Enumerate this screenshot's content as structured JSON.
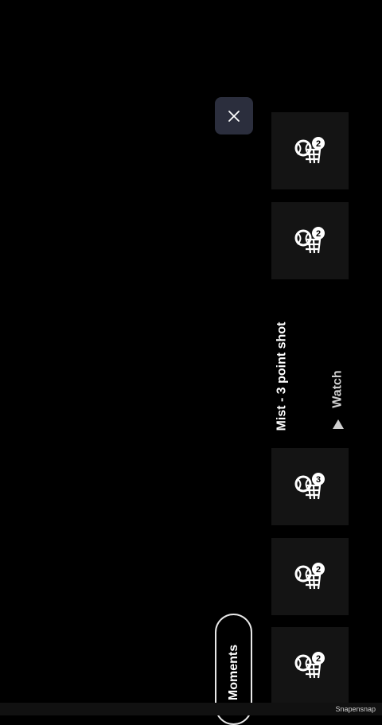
{
  "header": {
    "close_icon": "close-icon"
  },
  "moments": [
    {
      "icon": "basketball-hoop-icon",
      "count": "2"
    },
    {
      "icon": "basketball-hoop-icon",
      "count": "2"
    },
    {
      "icon": "basketball-hoop-icon",
      "count": "3"
    },
    {
      "icon": "basketball-hoop-icon",
      "count": "2"
    },
    {
      "icon": "basketball-hoop-icon",
      "count": "2"
    }
  ],
  "event": {
    "title": "Mist - 3 point shot",
    "watch_label": "Watch",
    "play_icon": "play-icon"
  },
  "footer": {
    "moments_label": "Moments",
    "brand": "Snapensnap"
  },
  "colors": {
    "background": "#000000",
    "tile": "#141414",
    "close_button": "#2b2e3d"
  }
}
